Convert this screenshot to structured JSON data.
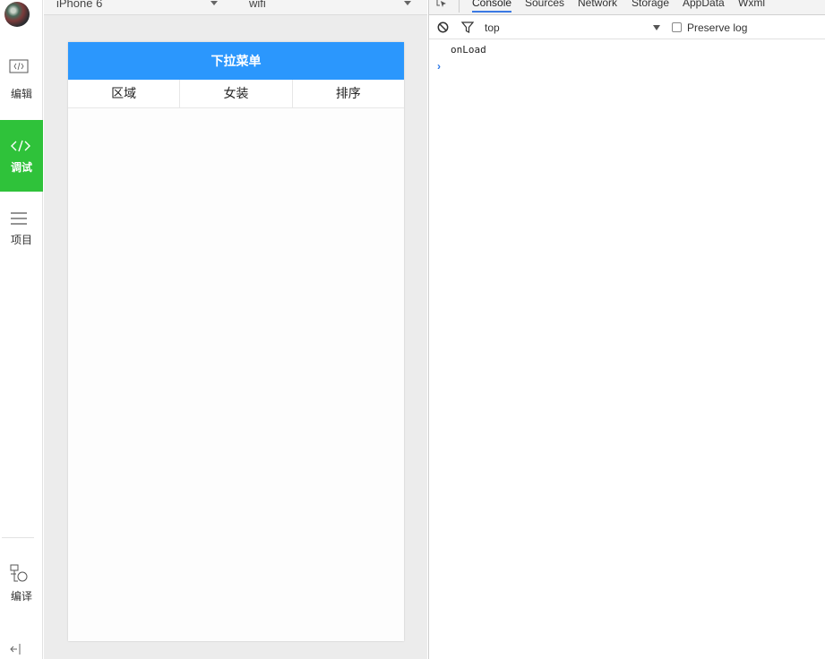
{
  "rail": {
    "items": [
      {
        "label": "编辑",
        "icon": "code-window-icon"
      },
      {
        "label": "调试",
        "icon": "code-icon"
      },
      {
        "label": "项目",
        "icon": "menu-lines-icon"
      },
      {
        "label": "编译",
        "icon": "compile-icon"
      }
    ],
    "active_color": "#2fc23a"
  },
  "simulator": {
    "device": "iPhone 6",
    "network": "wifi",
    "navbar_title": "下拉菜单",
    "navbar_color": "#2b97fd",
    "menu": [
      "区域",
      "女装",
      "排序"
    ]
  },
  "devtools": {
    "tabs": [
      "Console",
      "Sources",
      "Network",
      "Storage",
      "AppData",
      "Wxml"
    ],
    "active_tab": "Console",
    "context": "top",
    "preserve_log_label": "Preserve log",
    "preserve_log_checked": false,
    "console_lines": [
      "onLoad"
    ],
    "prompt": "›"
  }
}
